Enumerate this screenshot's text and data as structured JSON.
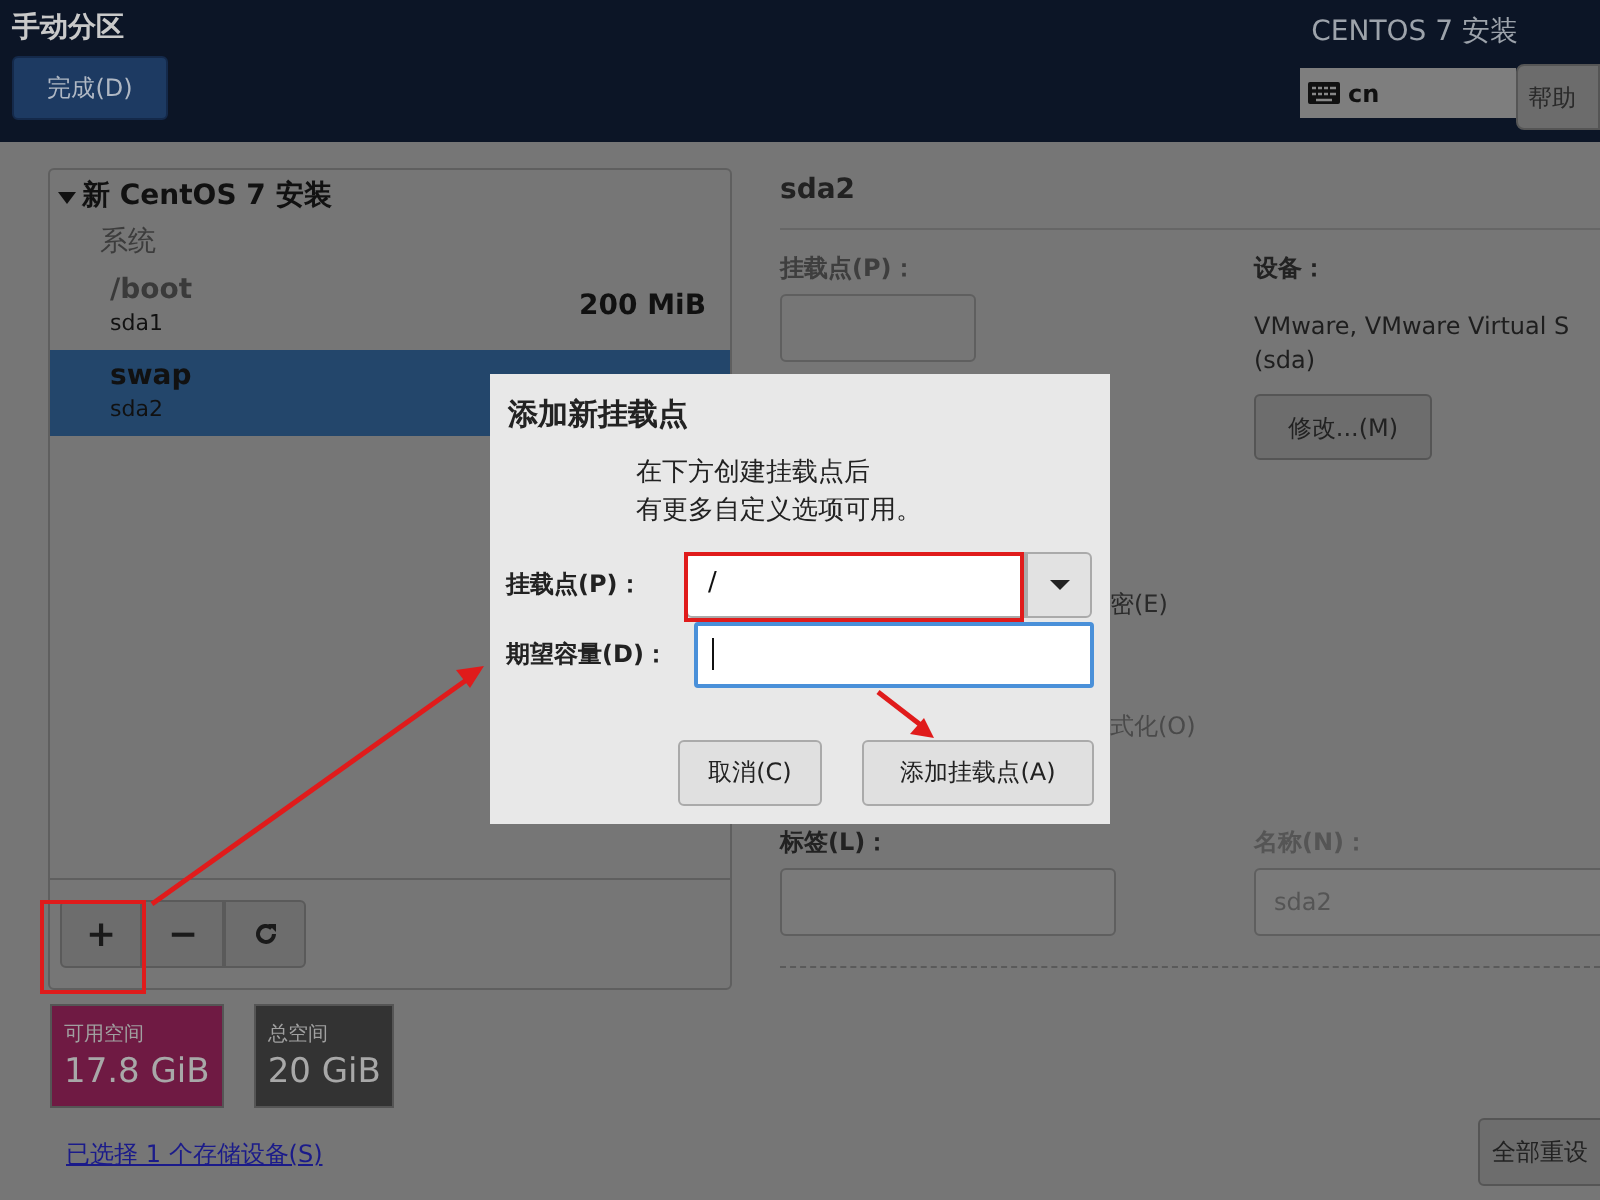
{
  "header": {
    "title": "手动分区",
    "done_button": "完成(D)",
    "product": "CENTOS 7 安装",
    "keyboard_layout": "cn",
    "help_button": "帮助"
  },
  "partitions": {
    "group": "新 CentOS 7 安装",
    "expanded": true,
    "section": "系统",
    "items": [
      {
        "mount": "/boot",
        "device": "sda1",
        "size": "200 MiB",
        "selected": false
      },
      {
        "mount": "swap",
        "device": "sda2",
        "selected": true
      }
    ],
    "toolbar": [
      {
        "kind": "add",
        "label": "+"
      },
      {
        "kind": "remove",
        "label": "−"
      },
      {
        "kind": "refresh"
      }
    ]
  },
  "space": [
    {
      "label": "可用空间",
      "value": "17.8 GiB",
      "color": "#6f1a43"
    },
    {
      "label": "总空间",
      "value": "20 GiB",
      "color": "#333333"
    }
  ],
  "storage_link": "已选择 1 个存储设备(S)",
  "details": {
    "title": "sda2",
    "mount_label": "挂载点(P)：",
    "mount_disabled": true,
    "device_label": "设备：",
    "device_lines": [
      "VMware, VMware Virtual S",
      "(sda)"
    ],
    "modify_button": "修改...(M)",
    "encrypt_fragment": "密(E)",
    "reformat_fragment": "式化(O)",
    "label_label": "标签(L)：",
    "name_label": "名称(N)：",
    "name_value": "sda2"
  },
  "reset_button": "全部重设",
  "dialog": {
    "title": "添加新挂载点",
    "message": [
      "在下方创建挂载点后",
      "有更多自定义选项可用。"
    ],
    "mount_label": "挂载点(P)：",
    "mount_value": "/",
    "capacity_label": "期望容量(D)：",
    "capacity_focused": true,
    "cancel_button": "取消(C)",
    "add_button": "添加挂载点(A)"
  }
}
